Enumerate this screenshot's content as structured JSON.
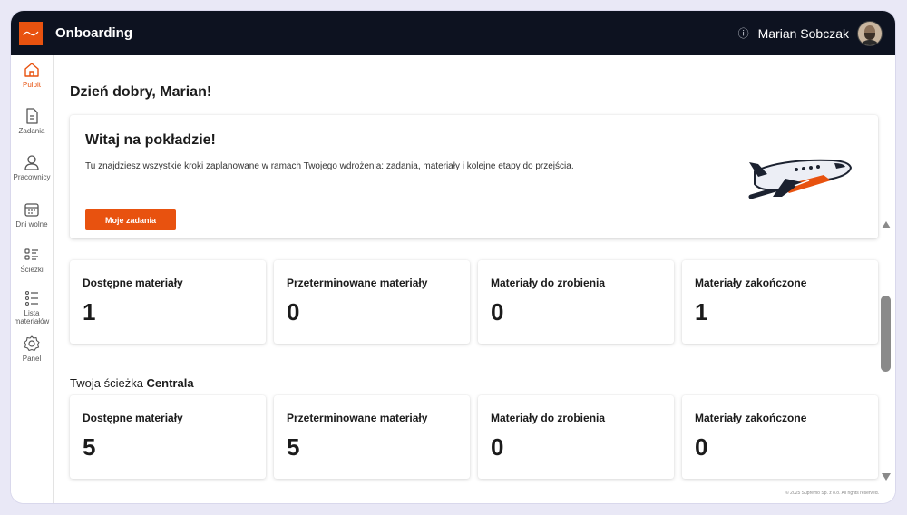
{
  "app": {
    "title": "Onboarding"
  },
  "user": {
    "name": "Marian Sobczak"
  },
  "sidebar": {
    "items": [
      {
        "label": "Pulpit",
        "icon": "home-icon",
        "active": true
      },
      {
        "label": "Zadania",
        "icon": "document-icon"
      },
      {
        "label": "Pracownicy",
        "icon": "person-icon"
      },
      {
        "label": "Dni wolne",
        "icon": "calendar-icon"
      },
      {
        "label": "Ścieżki",
        "icon": "list-icon"
      },
      {
        "label": "Lista materiałów",
        "icon": "checklist-icon"
      },
      {
        "label": "Panel",
        "icon": "gear-icon"
      }
    ]
  },
  "main": {
    "greeting": "Dzień dobry, Marian!",
    "welcome": {
      "title": "Witaj na pokładzie!",
      "text": "Tu znajdziesz wszystkie kroki zaplanowane w ramach Twojego wdrożenia: zadania, materiały i kolejne etapy do przejścia.",
      "button": "Moje zadania"
    },
    "stats": [
      {
        "label": "Dostępne materiały",
        "value": "1"
      },
      {
        "label": "Przeterminowane materiały",
        "value": "0"
      },
      {
        "label": "Materiały do zrobienia",
        "value": "0"
      },
      {
        "label": "Materiały zakończone",
        "value": "1"
      }
    ],
    "path_section": {
      "prefix": "Twoja ścieżka",
      "name": "Centrala"
    },
    "path_stats": [
      {
        "label": "Dostępne materiały",
        "value": "5"
      },
      {
        "label": "Przeterminowane materiały",
        "value": "5"
      },
      {
        "label": "Materiały do zrobienia",
        "value": "0"
      },
      {
        "label": "Materiały zakończone",
        "value": "0"
      }
    ],
    "footer": "© 2025 Supremo Sp. z o.o. All rights reserved."
  },
  "colors": {
    "accent": "#e8520f",
    "topbar": "#0d1220",
    "background": "#ffffff"
  }
}
